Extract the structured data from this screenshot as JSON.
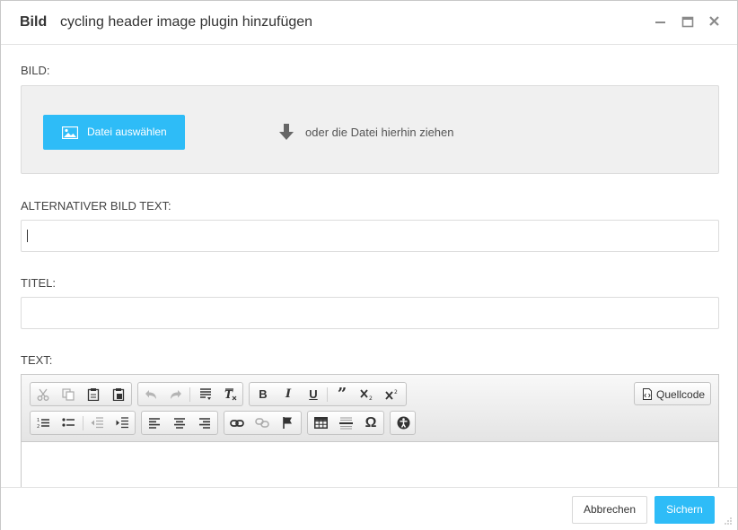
{
  "header": {
    "title_strong": "Bild",
    "title_sub": "cycling header image plugin hinzufügen"
  },
  "fields": {
    "image_label": "BILD:",
    "file_button": "Datei auswählen",
    "drop_text": "oder die Datei hierhin ziehen",
    "alt_label": "ALTERNATIVER BILD TEXT:",
    "alt_value": "",
    "title_label": "TITEL:",
    "title_value": "",
    "text_label": "TEXT:"
  },
  "toolbar": {
    "source_label": "Quellcode"
  },
  "footer": {
    "cancel_label": "Abbrechen",
    "save_label": "Sichern"
  },
  "colors": {
    "accent": "#2ebcf7"
  }
}
